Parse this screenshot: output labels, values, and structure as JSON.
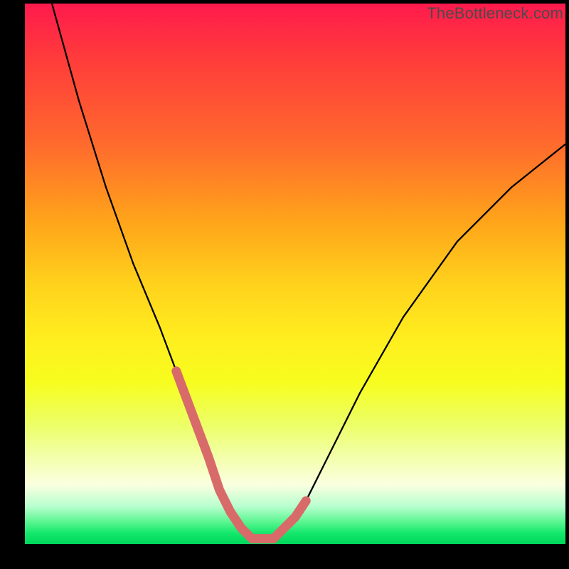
{
  "watermark": "TheBottleneck.com",
  "chart_data": {
    "type": "line",
    "title": "",
    "xlabel": "",
    "ylabel": "",
    "xlim": [
      0,
      100
    ],
    "ylim": [
      0,
      100
    ],
    "series": [
      {
        "name": "curve",
        "color": "#000000",
        "x": [
          5,
          10,
          15,
          20,
          25,
          28,
          31,
          34,
          36,
          38,
          40,
          42,
          44,
          46,
          48,
          52,
          56,
          62,
          70,
          80,
          90,
          100
        ],
        "values": [
          100,
          82,
          66,
          52,
          40,
          32,
          24,
          16,
          10,
          6,
          3,
          1,
          1,
          1,
          3,
          8,
          16,
          28,
          42,
          56,
          66,
          74
        ]
      },
      {
        "name": "highlight-left",
        "color": "#d86a6a",
        "x": [
          28,
          31,
          34,
          36,
          38
        ],
        "values": [
          32,
          24,
          16,
          10,
          6
        ]
      },
      {
        "name": "highlight-bottom",
        "color": "#d86a6a",
        "x": [
          38,
          40,
          42,
          44,
          46
        ],
        "values": [
          6,
          3,
          1,
          1,
          1
        ]
      },
      {
        "name": "highlight-right",
        "color": "#d86a6a",
        "x": [
          46,
          48,
          50,
          52
        ],
        "values": [
          1,
          3,
          5,
          8
        ]
      }
    ],
    "background_gradient": {
      "direction": "top-to-bottom",
      "stops": [
        {
          "pos": 0.0,
          "color": "#ff1a4d"
        },
        {
          "pos": 0.1,
          "color": "#ff3b3b"
        },
        {
          "pos": 0.26,
          "color": "#ff6a2d"
        },
        {
          "pos": 0.4,
          "color": "#ffa31a"
        },
        {
          "pos": 0.52,
          "color": "#ffd21c"
        },
        {
          "pos": 0.62,
          "color": "#ffee1f"
        },
        {
          "pos": 0.7,
          "color": "#f7fd1e"
        },
        {
          "pos": 0.78,
          "color": "#ecff68"
        },
        {
          "pos": 0.84,
          "color": "#f3ffac"
        },
        {
          "pos": 0.89,
          "color": "#fbffe0"
        },
        {
          "pos": 0.93,
          "color": "#b8ffcf"
        },
        {
          "pos": 0.96,
          "color": "#57f58e"
        },
        {
          "pos": 0.98,
          "color": "#13e86b"
        },
        {
          "pos": 1.0,
          "color": "#00d65c"
        }
      ]
    }
  }
}
